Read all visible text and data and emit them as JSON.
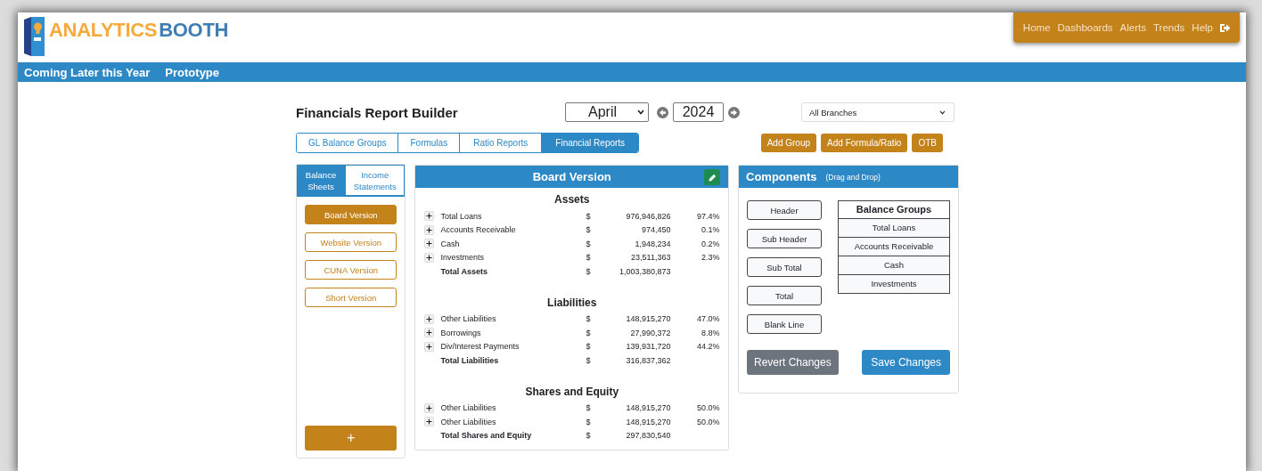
{
  "brand": {
    "word_1": "ANALYTICS",
    "word_2": "BOOTH"
  },
  "nav": [
    {
      "label": "Home"
    },
    {
      "label": "Dashboards"
    },
    {
      "label": "Alerts"
    },
    {
      "label": "Trends"
    },
    {
      "label": "Help"
    }
  ],
  "menu_bar": [
    {
      "label": "Coming Later this Year"
    },
    {
      "label": "Prototype"
    }
  ],
  "title": "Financials Report Builder",
  "month": {
    "value": "April"
  },
  "year": {
    "value": "2024"
  },
  "branch": {
    "value": "All Branches"
  },
  "tabs": [
    {
      "label": "GL Balance Groups",
      "selected": false
    },
    {
      "label": "Formulas",
      "selected": false
    },
    {
      "label": "Ratio Reports",
      "selected": false
    },
    {
      "label": "Financial Reports",
      "selected": true
    }
  ],
  "actions": [
    {
      "label": "Add Group"
    },
    {
      "label": "Add Formula/Ratio"
    },
    {
      "label": "OTB"
    }
  ],
  "report_types": [
    {
      "label": "Balance Sheets",
      "selected": true
    },
    {
      "label": "Income Statements",
      "selected": false
    }
  ],
  "reports": [
    {
      "label": "Board Version",
      "selected": true
    },
    {
      "label": "Website Version",
      "selected": false
    },
    {
      "label": "CUNA Version",
      "selected": false
    },
    {
      "label": "Short Version",
      "selected": false
    }
  ],
  "add_report_button": "+",
  "report": {
    "title": "Board Version",
    "sections": [
      {
        "heading": "Assets",
        "rows": [
          {
            "kind": "item",
            "label": "Total Loans",
            "currency": "$",
            "amount": "976,946,826",
            "percent": "97.4%"
          },
          {
            "kind": "item",
            "label": "Accounts Receivable",
            "currency": "$",
            "amount": "974,450",
            "percent": "0.1%"
          },
          {
            "kind": "item",
            "label": "Cash",
            "currency": "$",
            "amount": "1,948,234",
            "percent": "0.2%"
          },
          {
            "kind": "item",
            "label": "Investments",
            "currency": "$",
            "amount": "23,511,363",
            "percent": "2.3%"
          },
          {
            "kind": "total",
            "label": "Total Assets",
            "currency": "$",
            "amount": "1,003,380,873"
          }
        ]
      },
      {
        "heading": "Liabilities",
        "rows": [
          {
            "kind": "item",
            "label": "Other Liabilities",
            "currency": "$",
            "amount": "148,915,270",
            "percent": "47.0%"
          },
          {
            "kind": "item",
            "label": "Borrowings",
            "currency": "$",
            "amount": "27,990,372",
            "percent": "8.8%"
          },
          {
            "kind": "item",
            "label": "Div/Interest Payments",
            "currency": "$",
            "amount": "139,931,720",
            "percent": "44.2%"
          },
          {
            "kind": "total",
            "label": "Total Liabilities",
            "currency": "$",
            "amount": "316,837,362"
          }
        ]
      },
      {
        "heading": "Shares and Equity",
        "rows": [
          {
            "kind": "item",
            "label": "Other Liabilities",
            "currency": "$",
            "amount": "148,915,270",
            "percent": "50.0%"
          },
          {
            "kind": "item",
            "label": "Other Liabilities",
            "currency": "$",
            "amount": "148,915,270",
            "percent": "50.0%"
          },
          {
            "kind": "total",
            "label": "Total Shares and Equity",
            "currency": "$",
            "amount": "297,830,540"
          }
        ]
      }
    ]
  },
  "components": {
    "title": "Components",
    "hint": "(Drag and Drop)",
    "items": [
      {
        "label": "Header"
      },
      {
        "label": "Sub Header"
      },
      {
        "label": "Sub Total"
      },
      {
        "label": "Total"
      },
      {
        "label": "Blank Line"
      }
    ],
    "groups_title": "Balance Groups",
    "groups": [
      {
        "label": "Total Loans"
      },
      {
        "label": "Accounts Receivable"
      },
      {
        "label": "Cash"
      },
      {
        "label": "Investments"
      }
    ],
    "buttons": [
      {
        "label": "Revert Changes",
        "kind": "secondary"
      },
      {
        "label": "Save Changes",
        "kind": "primary"
      }
    ]
  }
}
